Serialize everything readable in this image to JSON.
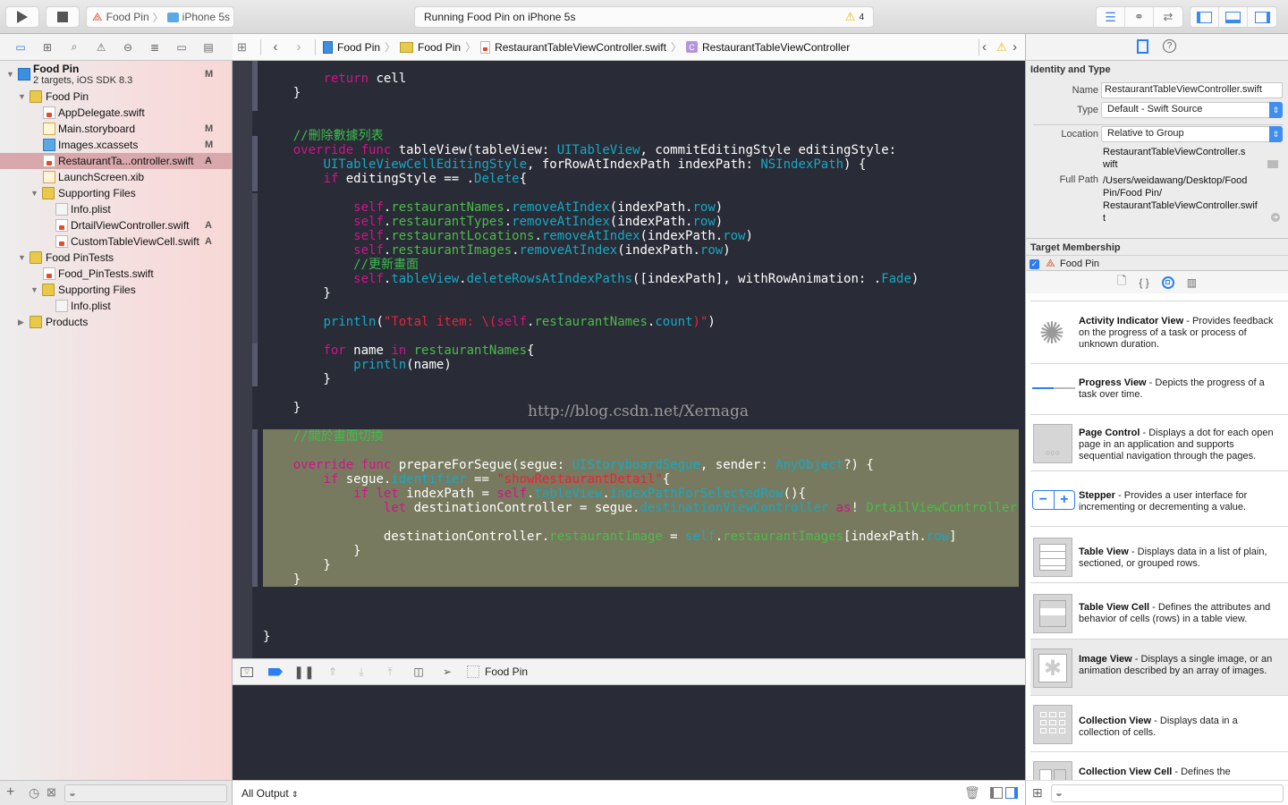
{
  "toolbar": {
    "scheme_project": "Food Pin",
    "scheme_device": "iPhone 5s",
    "status_text": "Running Food Pin on iPhone 5s",
    "warning_count": "4"
  },
  "navigator": {
    "items": [
      {
        "label": "Food Pin",
        "sub": "2 targets, iOS SDK 8.3",
        "badge": "M",
        "type": "project"
      },
      {
        "label": "Food Pin",
        "type": "folder"
      },
      {
        "label": "AppDelegate.swift",
        "type": "swift"
      },
      {
        "label": "Main.storyboard",
        "badge": "M",
        "type": "storyboard"
      },
      {
        "label": "Images.xcassets",
        "badge": "M",
        "type": "xcassets"
      },
      {
        "label": "RestaurantTa...ontroller.swift",
        "badge": "A",
        "type": "swift",
        "selected": true
      },
      {
        "label": "LaunchScreen.xib",
        "type": "xib"
      },
      {
        "label": "Supporting Files",
        "type": "folder"
      },
      {
        "label": "Info.plist",
        "type": "plist"
      },
      {
        "label": "DrtailViewController.swift",
        "badge": "A",
        "type": "swift"
      },
      {
        "label": "CustomTableViewCell.swift",
        "badge": "A",
        "type": "swift"
      },
      {
        "label": "Food PinTests",
        "type": "folder"
      },
      {
        "label": "Food_PinTests.swift",
        "type": "swift"
      },
      {
        "label": "Supporting Files",
        "type": "folder"
      },
      {
        "label": "Info.plist",
        "type": "plist"
      },
      {
        "label": "Products",
        "type": "folder"
      }
    ]
  },
  "jumpbar": {
    "crumbs": [
      "Food Pin",
      "Food Pin",
      "RestaurantTableViewController.swift",
      "RestaurantTableViewController"
    ]
  },
  "editor": {
    "watermark": "http://blog.csdn.net/Xernaga",
    "comment_delete": "//刪除數據列表",
    "comment_refresh": "//更新畫面",
    "comment_segue": "//關於畫面切換",
    "string_total": "\"Total item: \\(",
    "string_segue_id": "\"showRestaurantDetail\""
  },
  "debugbar": {
    "target": "Food Pin"
  },
  "console": {
    "output_selector": "All Output"
  },
  "inspector": {
    "section_identity": "Identity and Type",
    "name_label": "Name",
    "name_value": "RestaurantTableViewController.swift",
    "type_label": "Type",
    "type_value": "Default - Swift Source",
    "location_label": "Location",
    "location_value": "Relative to Group",
    "relpath_line1": "RestaurantTableViewController.s",
    "relpath_line2": "wift",
    "fullpath_label": "Full Path",
    "fullpath_line1": "/Users/weidawang/Desktop/Food",
    "fullpath_line2": "Pin/Food Pin/",
    "fullpath_line3": "RestaurantTableViewController.swif",
    "fullpath_line4": "t",
    "section_target": "Target Membership",
    "target_name": "Food Pin",
    "target_checked": true
  },
  "library": {
    "items": [
      {
        "title": "Activity Indicator View",
        "desc": " - Provides feedback on the progress of a task or process of unknown duration."
      },
      {
        "title": "Progress View",
        "desc": " - Depicts the progress of a task over time."
      },
      {
        "title": "Page Control",
        "desc": " - Displays a dot for each open page in an application and supports sequential navigation through the pages."
      },
      {
        "title": "Stepper",
        "desc": " - Provides a user interface for incrementing or decrementing a value."
      },
      {
        "title": "Table View",
        "desc": " - Displays data in a list of plain, sectioned, or grouped rows."
      },
      {
        "title": "Table View Cell",
        "desc": " - Defines the attributes and behavior of cells (rows) in a table view."
      },
      {
        "title": "Image View",
        "desc": " - Displays a single image, or an animation described by an array of images."
      },
      {
        "title": "Collection View",
        "desc": " - Displays data in a collection of cells."
      },
      {
        "title": "Collection View Cell",
        "desc": " - Defines the"
      }
    ]
  }
}
